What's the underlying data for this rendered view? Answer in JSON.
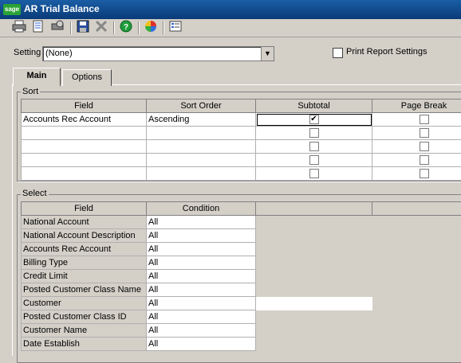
{
  "window": {
    "title": "AR Trial Balance",
    "logo_text": "sage"
  },
  "toolbar": {
    "icons": [
      "printer-icon",
      "print-preview-icon",
      "print-setup-icon",
      "save-icon",
      "delete-icon",
      "help-icon",
      "report-wizard-icon",
      "settings-list-icon"
    ]
  },
  "setting": {
    "label": "Setting",
    "value": "(None)"
  },
  "print_report_settings": {
    "label": "Print Report Settings",
    "checked": false
  },
  "tabs": [
    {
      "label": "Main",
      "active": true
    },
    {
      "label": "Options",
      "active": false
    }
  ],
  "sort": {
    "label": "Sort",
    "columns": [
      "Field",
      "Sort Order",
      "Subtotal",
      "Page Break"
    ],
    "rows": [
      {
        "field": "Accounts Rec Account",
        "order": "Ascending",
        "subtotal": true,
        "page_break": false
      },
      {
        "field": "",
        "order": "",
        "subtotal": false,
        "page_break": false
      },
      {
        "field": "",
        "order": "",
        "subtotal": false,
        "page_break": false
      },
      {
        "field": "",
        "order": "",
        "subtotal": false,
        "page_break": false
      },
      {
        "field": "",
        "order": "",
        "subtotal": false,
        "page_break": false
      }
    ]
  },
  "select": {
    "label": "Select",
    "columns": [
      "Field",
      "Condition"
    ],
    "rows": [
      {
        "field": "National Account",
        "condition": "All"
      },
      {
        "field": "National Account Description",
        "condition": "All"
      },
      {
        "field": "Accounts Rec Account",
        "condition": "All"
      },
      {
        "field": "Billing Type",
        "condition": "All"
      },
      {
        "field": "Credit Limit",
        "condition": "All"
      },
      {
        "field": "Posted Customer Class Name",
        "condition": "All"
      },
      {
        "field": "Customer",
        "condition": "All"
      },
      {
        "field": "Posted Customer Class ID",
        "condition": "All"
      },
      {
        "field": "Customer Name",
        "condition": "All"
      },
      {
        "field": "Date Establish",
        "condition": "All"
      }
    ]
  }
}
